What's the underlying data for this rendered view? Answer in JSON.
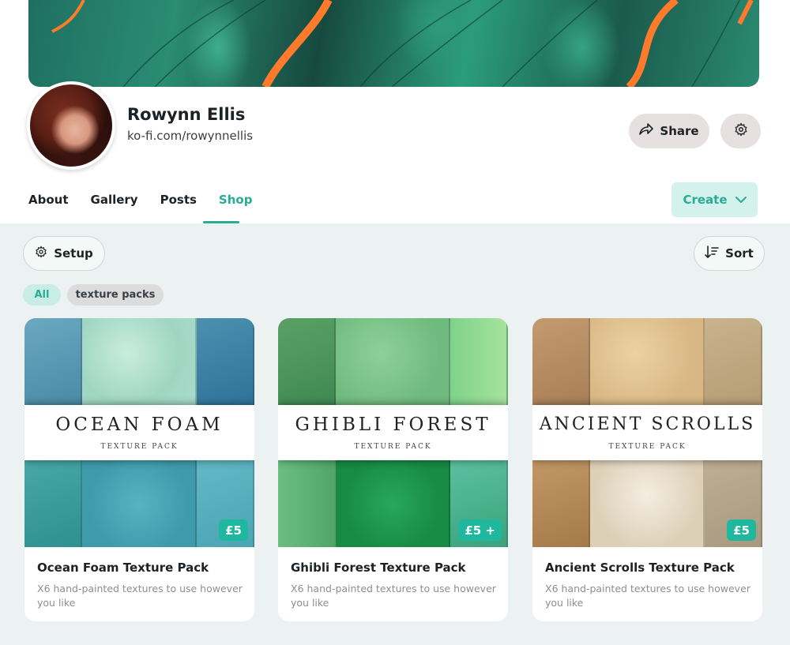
{
  "profile": {
    "name": "Rowynn Ellis",
    "url": "ko-fi.com/rowynnellis"
  },
  "actions": {
    "share_label": "Share",
    "create_label": "Create"
  },
  "tabs": [
    {
      "label": "About",
      "active": false
    },
    {
      "label": "Gallery",
      "active": false
    },
    {
      "label": "Posts",
      "active": false
    },
    {
      "label": "Shop",
      "active": true
    }
  ],
  "shop": {
    "setup_label": "Setup",
    "sort_label": "Sort",
    "filters": [
      {
        "label": "All",
        "selected": true
      },
      {
        "label": "texture packs",
        "selected": false
      }
    ],
    "products": [
      {
        "cover_title": "OCEAN FOAM",
        "cover_subtitle": "TEXTURE PACK",
        "price": "£5",
        "title": "Ocean Foam Texture Pack",
        "description": "X6 hand-painted textures to use however you like",
        "colors": [
          "#5a9bb5",
          "#a8dcc9",
          "#3f86a8",
          "#3a9ea0",
          "#4aaab8",
          "#52aec0"
        ]
      },
      {
        "cover_title": "GHIBLI FOREST",
        "cover_subtitle": "TEXTURE PACK",
        "price": "£5 +",
        "title": "Ghibli Forest Texture Pack",
        "description": "X6 hand-painted textures to use however you like",
        "colors": [
          "#4f9a5c",
          "#7cc48a",
          "#8fd890",
          "#5ab06e",
          "#1f9a52",
          "#46b48a"
        ]
      },
      {
        "cover_title": "ANCIENT SCROLLS",
        "cover_subtitle": "TEXTURE PACK",
        "price": "£5",
        "title": "Ancient Scrolls Texture Pack",
        "description": "X6 hand-painted textures to use however you like",
        "colors": [
          "#b8926a",
          "#e0c494",
          "#c4ad86",
          "#b08a5a",
          "#ece2d0",
          "#b3a48c"
        ]
      }
    ]
  },
  "colors": {
    "accent": "#29ab95",
    "price_badge": "#1fb89f",
    "shop_background": "#ebf2f1"
  }
}
